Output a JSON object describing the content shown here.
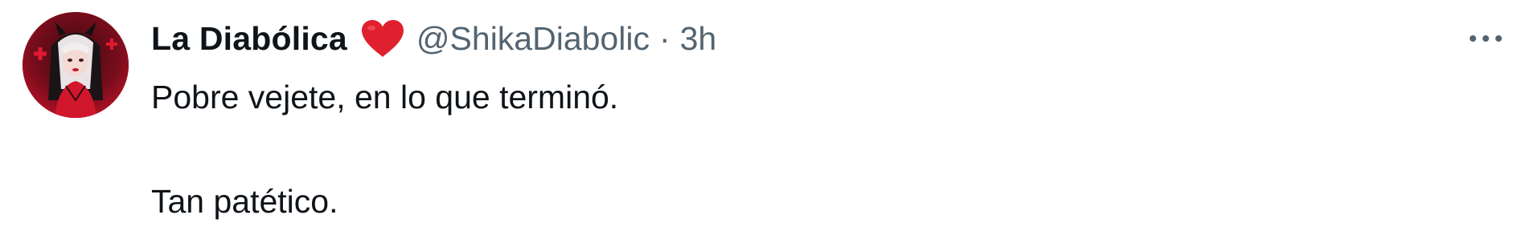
{
  "tweet": {
    "author": {
      "display_name": "La Diabólica",
      "badge_icon": "red-heart-icon",
      "handle": "@ShikaDiabolic",
      "separator": "·",
      "timestamp": "3h"
    },
    "more_icon": "more-options-icon",
    "body": {
      "line1": "Pobre vejete, en lo que terminó.",
      "line2": "Tan patético."
    }
  },
  "colors": {
    "text_primary": "#0f1419",
    "text_secondary": "#536471",
    "heart": "#e0202e",
    "avatar_bg": "#b01022"
  }
}
